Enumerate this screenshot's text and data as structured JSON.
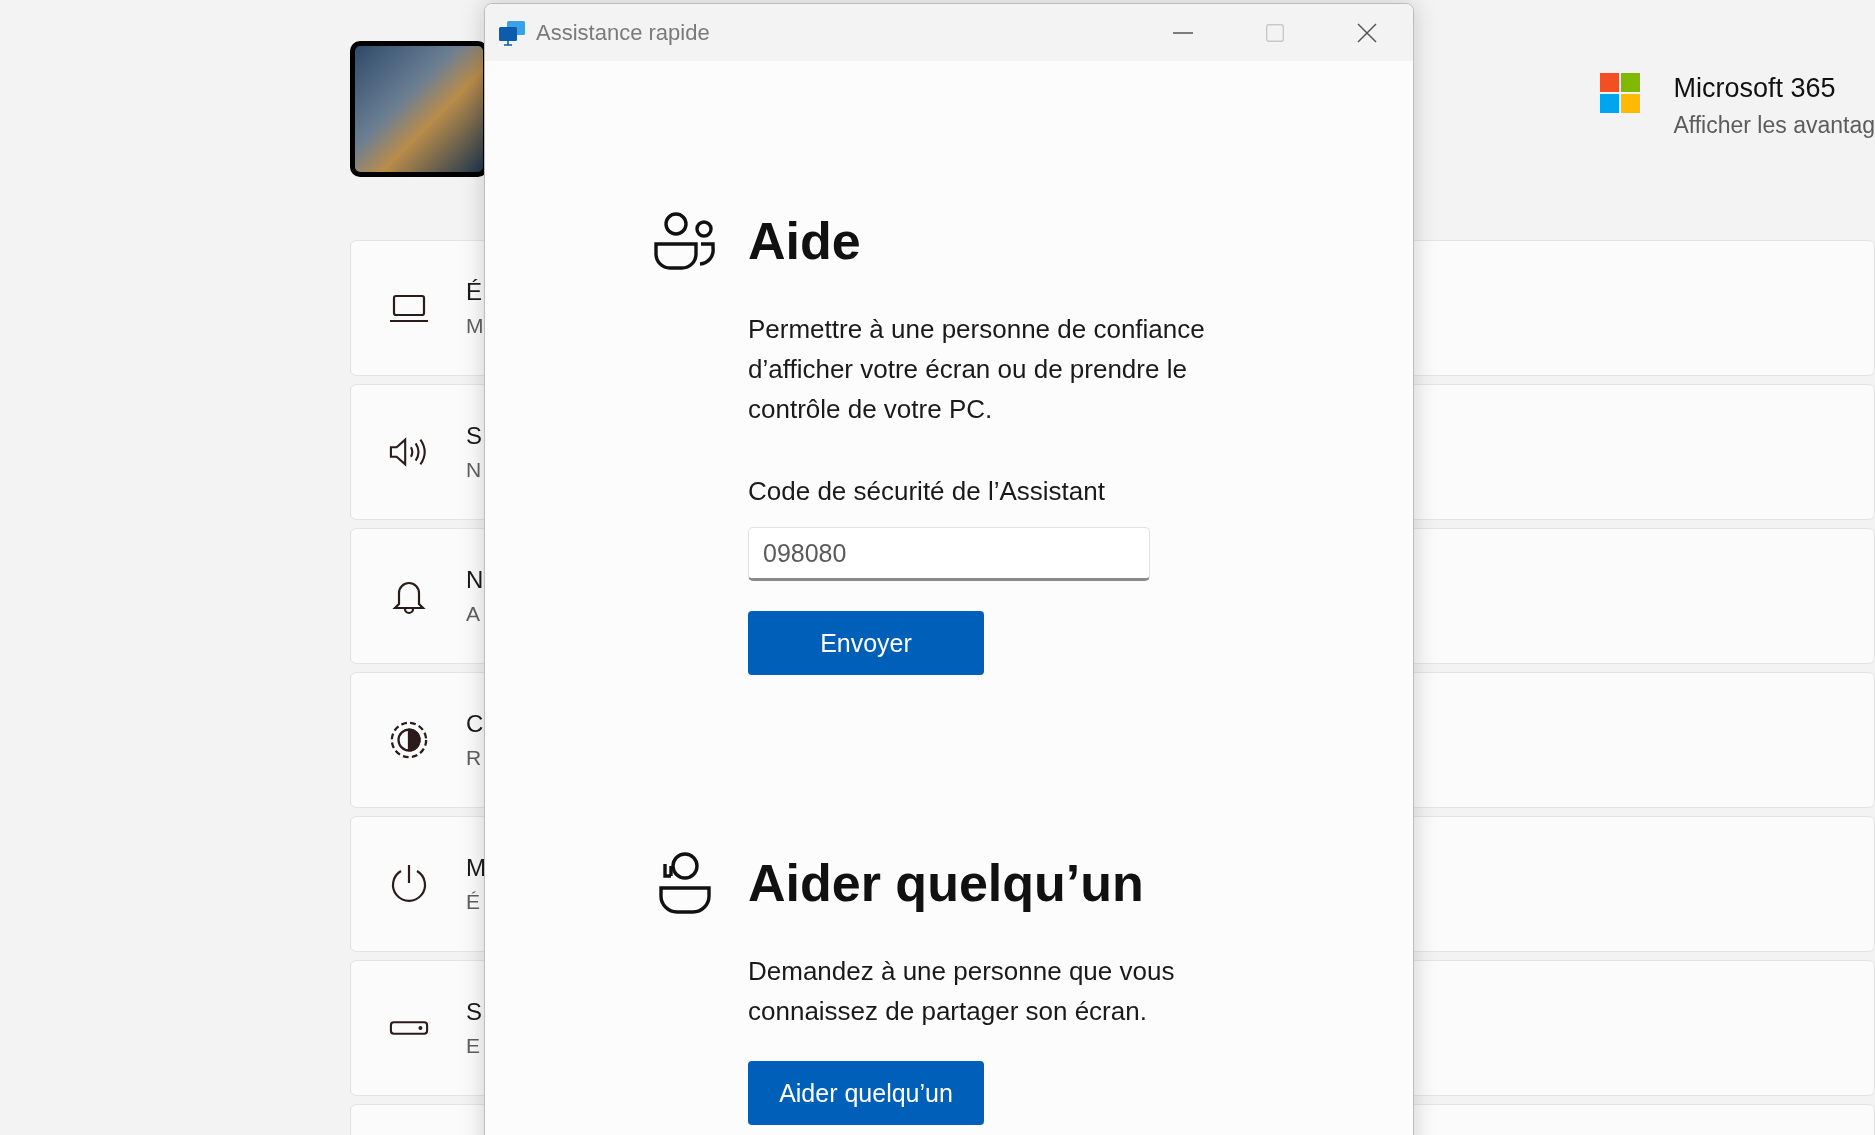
{
  "settings_cards": [
    {
      "kind": "laptop",
      "title": "É",
      "subtitle": "M"
    },
    {
      "kind": "speaker",
      "title": "S",
      "subtitle": "N"
    },
    {
      "kind": "bell",
      "title": "N",
      "subtitle": "A"
    },
    {
      "kind": "focus",
      "title": "C",
      "subtitle": "R"
    },
    {
      "kind": "power",
      "title": "M",
      "subtitle": "É"
    },
    {
      "kind": "storage",
      "title": "S",
      "subtitle": "E"
    },
    {
      "kind": "empty"
    }
  ],
  "promo": {
    "title": "Microsoft 365",
    "subtitle": "Afficher les avantag"
  },
  "window": {
    "title": "Assistance rapide"
  },
  "sections": [
    {
      "kind": "get_help",
      "heading": "Aide",
      "text": "Permettre à une personne de confiance d’afficher votre écran ou de prendre le contrôle de votre PC.",
      "field": {
        "label": "Code de sécurité de l’Assistant",
        "value": "098080"
      },
      "button": "Envoyer"
    },
    {
      "kind": "give_help",
      "heading": "Aider quelqu’un",
      "text": "Demandez à une personne que vous connaissez de partager son écran.",
      "button": "Aider quelqu’un"
    }
  ]
}
